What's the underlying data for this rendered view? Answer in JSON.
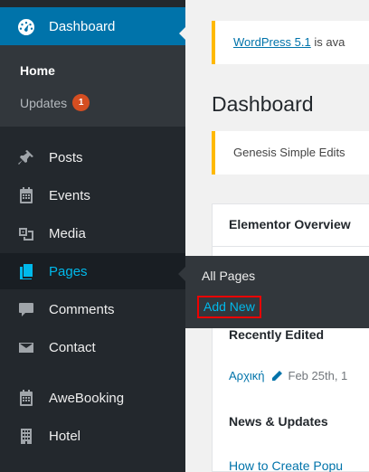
{
  "sidebar": {
    "dashboard_label": "Dashboard",
    "submenu": {
      "home": "Home",
      "updates": "Updates",
      "updates_count": "1"
    },
    "items": [
      {
        "label": "Posts",
        "icon": "pin-icon"
      },
      {
        "label": "Events",
        "icon": "calendar-icon"
      },
      {
        "label": "Media",
        "icon": "media-icon"
      },
      {
        "label": "Pages",
        "icon": "pages-icon"
      },
      {
        "label": "Comments",
        "icon": "comment-icon"
      },
      {
        "label": "Contact",
        "icon": "envelope-icon"
      },
      {
        "label": "AweBooking",
        "icon": "calendar-icon"
      },
      {
        "label": "Hotel",
        "icon": "building-icon"
      }
    ]
  },
  "flyout": {
    "all_pages": "All Pages",
    "add_new": "Add New"
  },
  "main": {
    "notice_link": "WordPress 5.1",
    "notice_rest": " is ava",
    "page_title": "Dashboard",
    "genesis_notice": "Genesis Simple Edits",
    "panel_title": "Elementor Overview",
    "recently_edited": "Recently Edited",
    "recent_item_title": "Αρχική",
    "recent_item_date": "Feb 25th, 1",
    "news_title": "News & Updates",
    "news_link": "How to Create Popu"
  },
  "colors": {
    "accent": "#0073aa",
    "sidebar_bg": "#23282d",
    "badge": "#d54e21",
    "highlight_border": "#ee0000"
  }
}
